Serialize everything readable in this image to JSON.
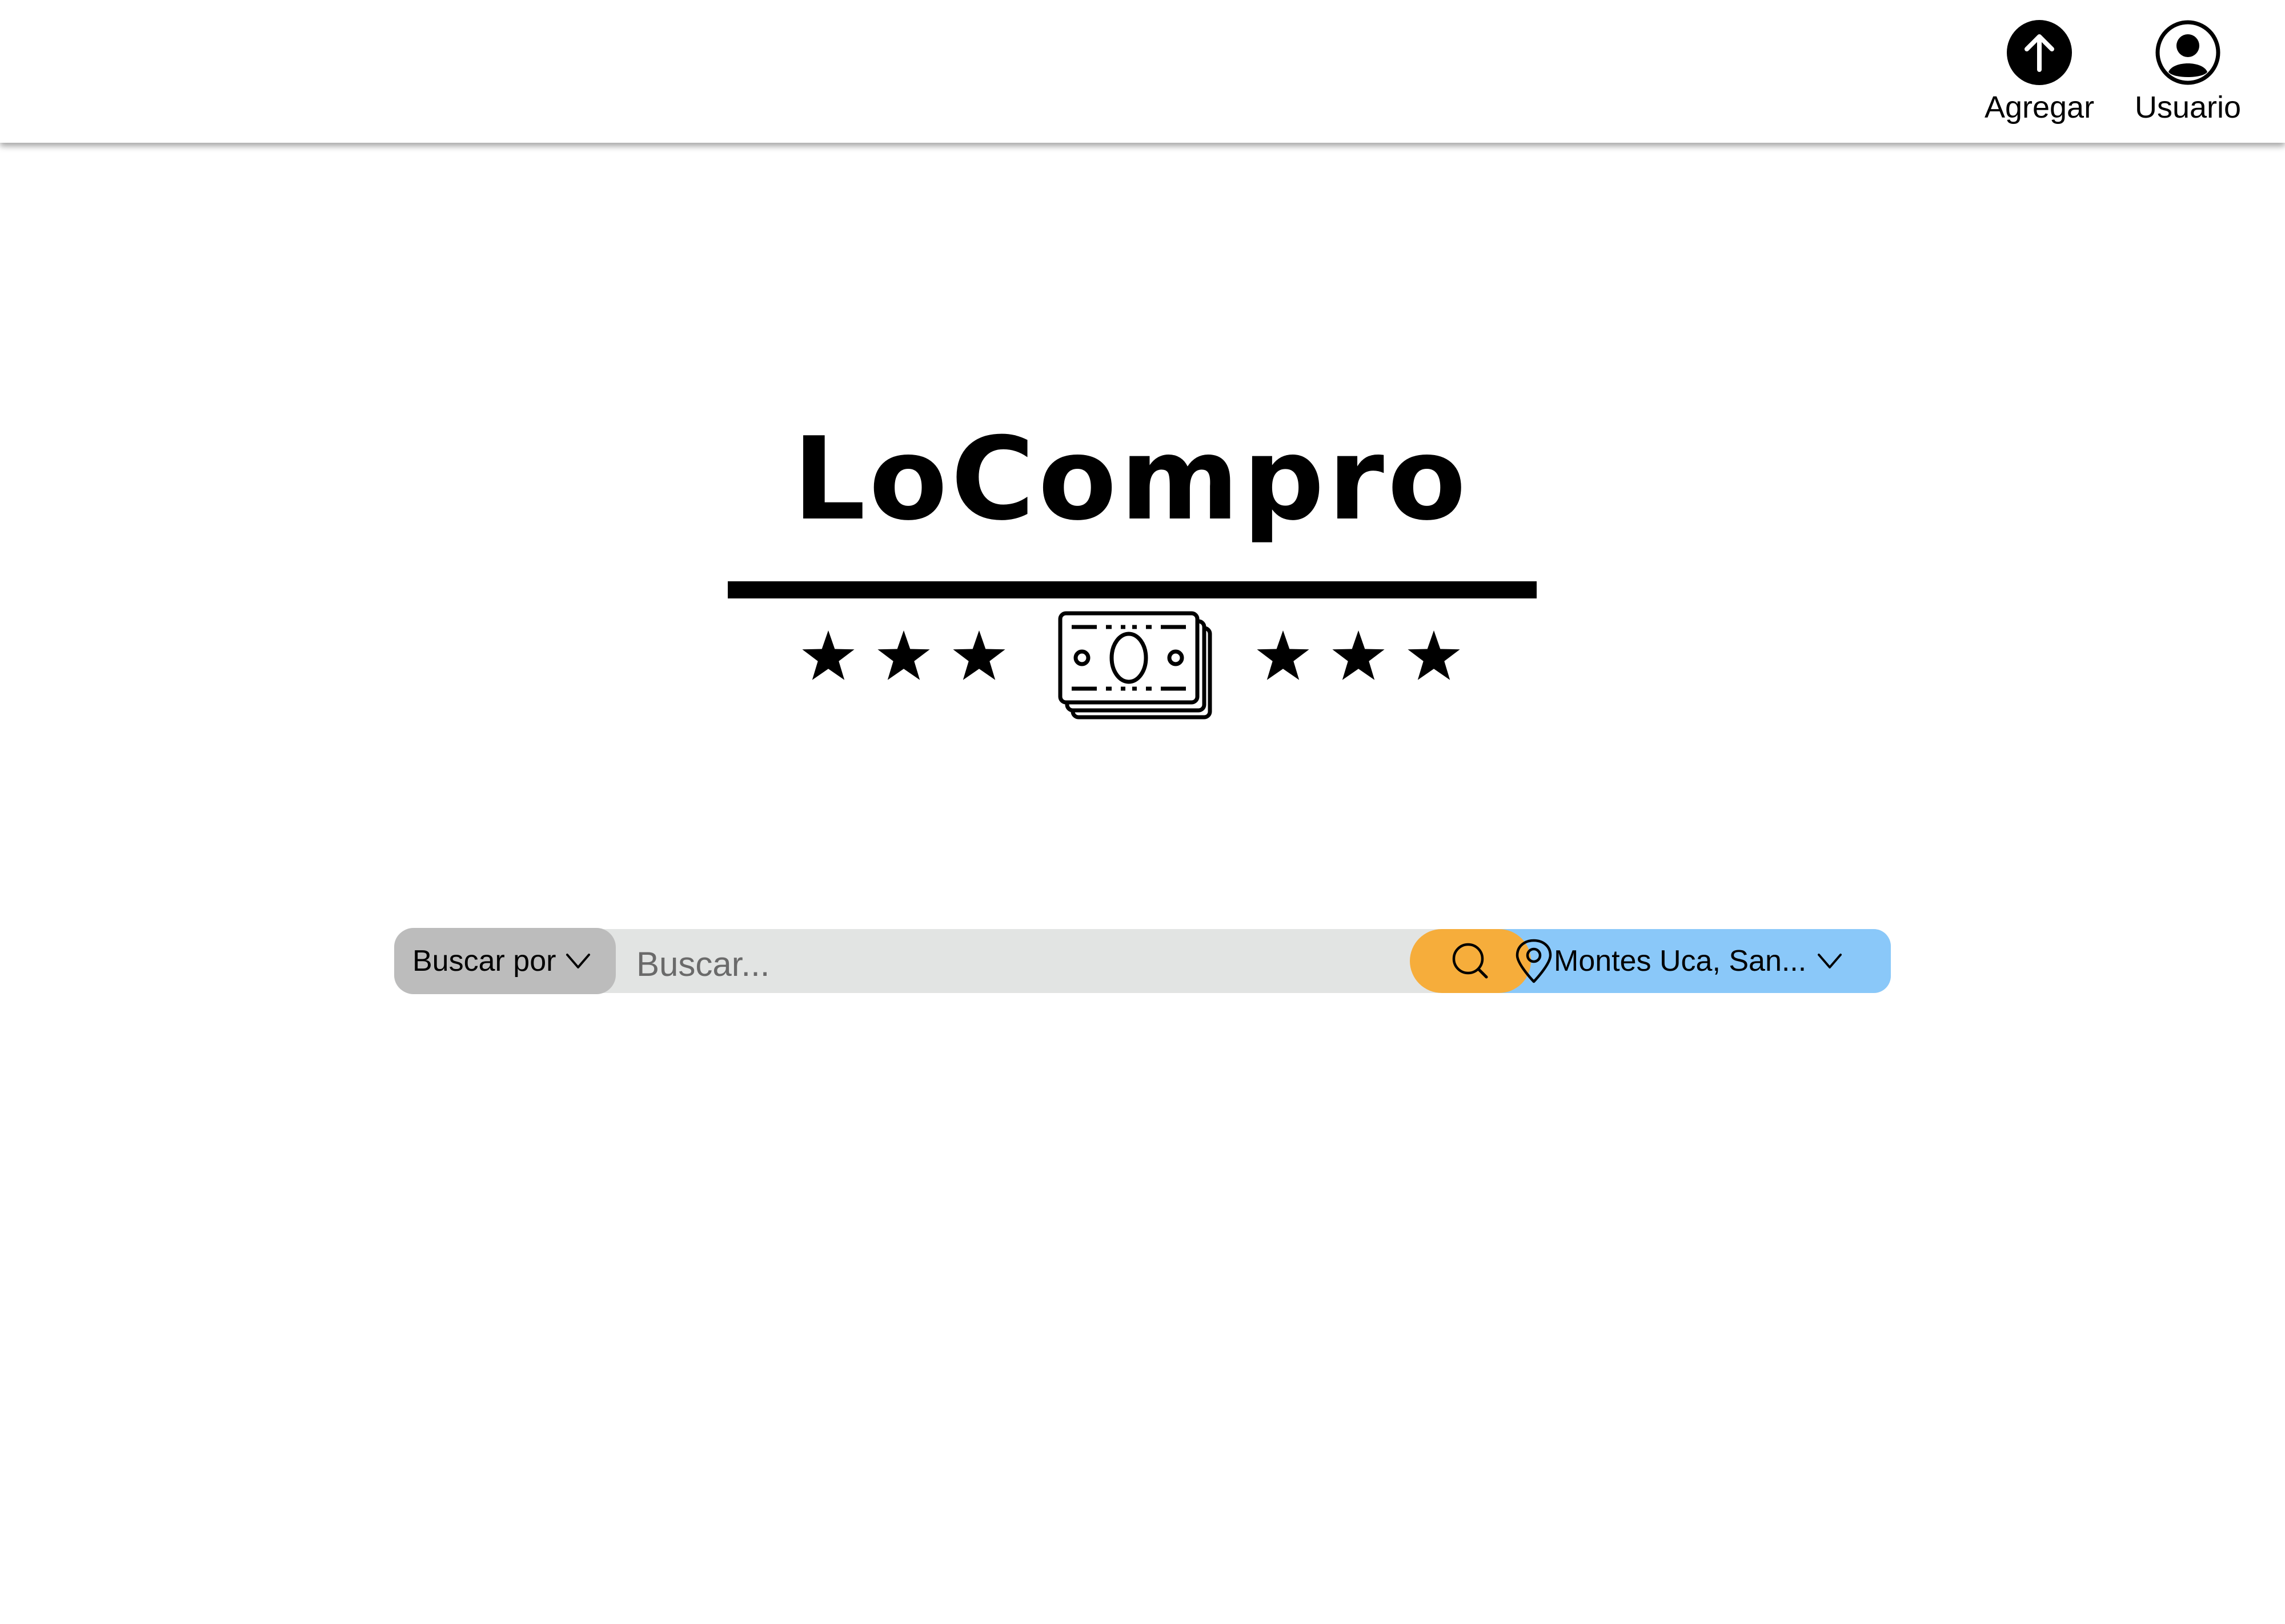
{
  "header": {
    "actions": [
      {
        "label": "Agregar",
        "icon": "upload-arrow-icon"
      },
      {
        "label": "Usuario",
        "icon": "user-circle-icon"
      }
    ]
  },
  "logo": {
    "title": "LoCompro",
    "icons": [
      "star-icon",
      "money-bills-icon"
    ]
  },
  "search": {
    "search_by_label": "Buscar por",
    "placeholder": "Buscar...",
    "value": "",
    "search_button_icon": "search-icon",
    "location_label": "Montes Uca, San...",
    "location_icon": "location-pin-icon"
  },
  "colors": {
    "search_button": "#f6ad3b",
    "location_pill": "#8ac8f9",
    "search_by_pill": "#bcbcbc",
    "search_track": "#e2e4e3"
  }
}
